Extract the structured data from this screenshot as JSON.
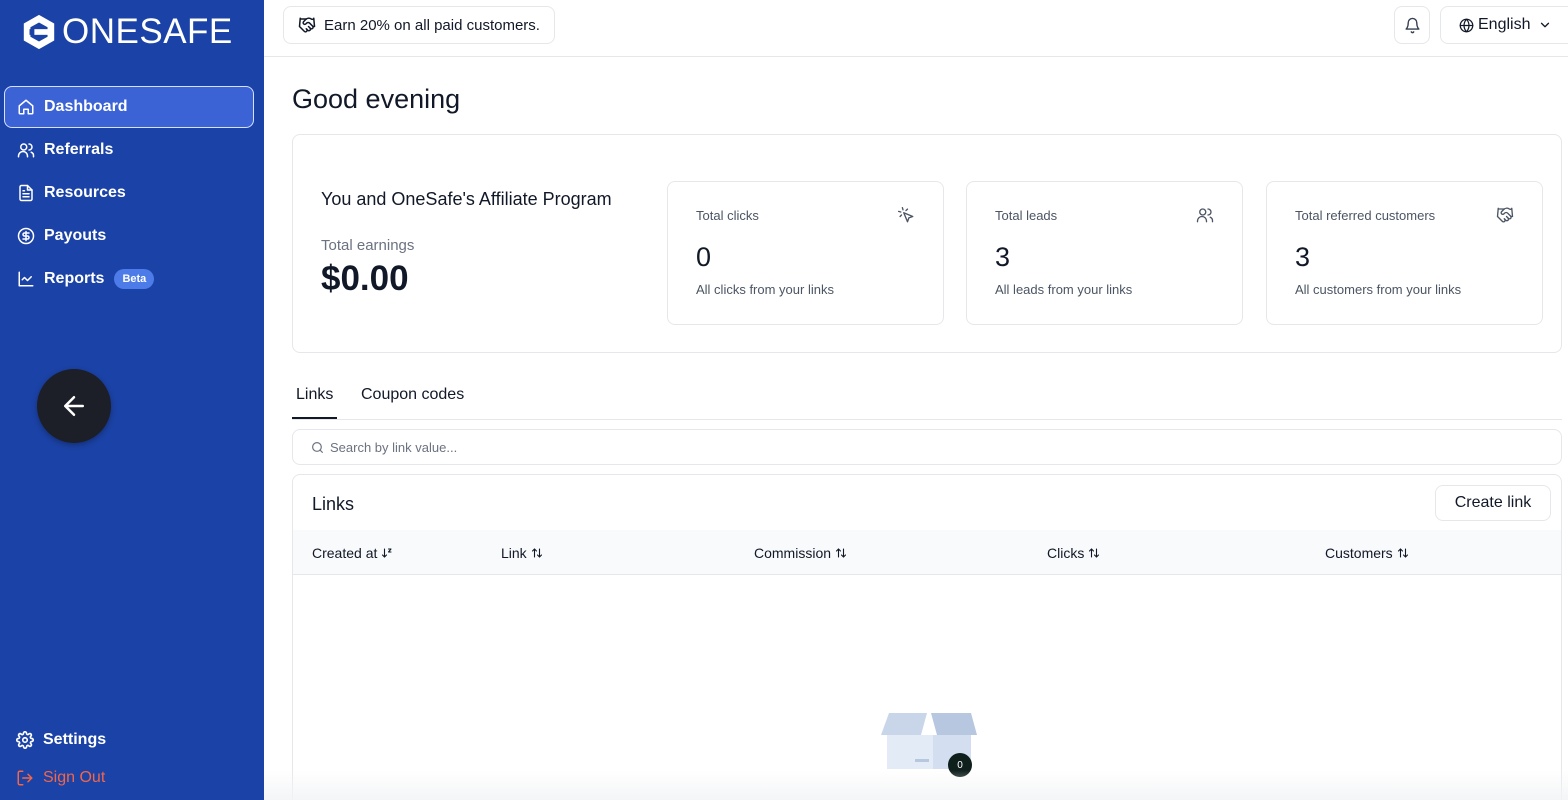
{
  "brand": {
    "name": "ONESAFE"
  },
  "sidebar": {
    "items": [
      {
        "label": "Dashboard",
        "icon": "home-icon",
        "active": true
      },
      {
        "label": "Referrals",
        "icon": "users-icon"
      },
      {
        "label": "Resources",
        "icon": "document-icon"
      },
      {
        "label": "Payouts",
        "icon": "dollar-circle-icon"
      },
      {
        "label": "Reports",
        "icon": "chart-line-icon",
        "badge": "Beta"
      }
    ],
    "settings_label": "Settings",
    "signout_label": "Sign Out"
  },
  "header": {
    "promo_text": "Earn 20% on all paid customers.",
    "language": "English"
  },
  "main": {
    "greeting": "Good evening",
    "program_title": "You and OneSafe's Affiliate Program",
    "earnings_label": "Total earnings",
    "earnings_value": "$0.00",
    "stats": [
      {
        "label": "Total clicks",
        "value": "0",
        "sub": "All clicks from your links",
        "icon": "cursor-click-icon"
      },
      {
        "label": "Total leads",
        "value": "3",
        "sub": "All leads from your links",
        "icon": "users-icon"
      },
      {
        "label": "Total referred customers",
        "value": "3",
        "sub": "All customers from your links",
        "icon": "handshake-icon"
      }
    ],
    "tabs": [
      {
        "label": "Links",
        "active": true
      },
      {
        "label": "Coupon codes"
      }
    ],
    "search_placeholder": "Search by link value...",
    "links": {
      "title": "Links",
      "create_label": "Create link",
      "columns": [
        "Created at",
        "Link",
        "Commission",
        "Clicks",
        "Customers"
      ],
      "empty_badge": "0"
    }
  },
  "colors": {
    "sidebar_bg": "#1b42a6",
    "active_item_bg": "#3b63d6",
    "signout": "#f2664a"
  }
}
